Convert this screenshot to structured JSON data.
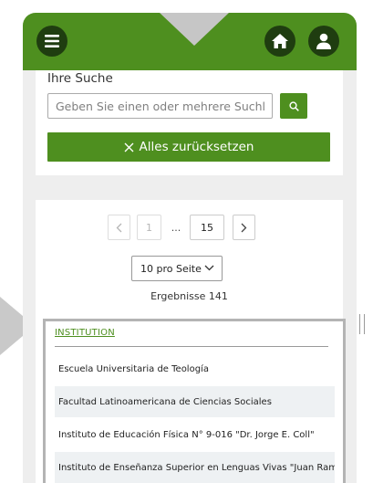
{
  "icons": {
    "menu": "hamburger-menu-icon",
    "home": "home-icon",
    "user": "user-icon",
    "search": "search-icon",
    "close": "close-icon",
    "prev": "chevron-left-icon",
    "next": "chevron-right-icon",
    "dropdown": "chevron-down-icon"
  },
  "colors": {
    "brand_green": "#4e8f1f",
    "dark_green": "#1f3d10",
    "row_alt": "#eef1f3"
  },
  "search": {
    "title": "Ihre Suche",
    "placeholder": "Geben Sie einen oder mehrere Suchl",
    "value": "",
    "reset_label": "Alles zurücksetzen"
  },
  "pagination": {
    "first_page": "1",
    "ellipsis": "...",
    "last_page": "15"
  },
  "page_size": {
    "selected": "10 pro Seite"
  },
  "results": {
    "count_text": "Ergebnisse 141",
    "column_header": "INSTITUTION",
    "rows": [
      "Escuela Universitaria de Teología",
      "Facultad Latinoamericana de Ciencias Sociales",
      "Instituto de Educación Física N° 9-016 \"Dr. Jorge E. Coll\"",
      "Instituto de Enseñanza Superior en Lenguas Vivas \"Juan Ram"
    ]
  }
}
